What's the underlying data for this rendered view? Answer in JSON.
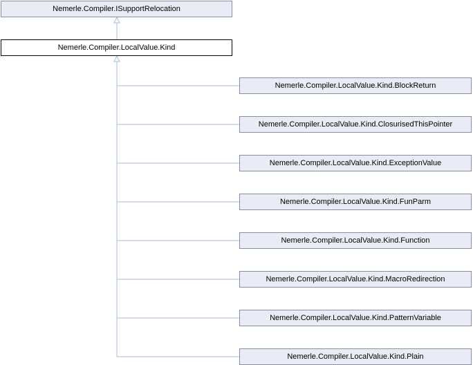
{
  "diagram": {
    "type": "class-inheritance",
    "colors": {
      "node_fill": "#e9ecf4",
      "node_border": "#868fa6",
      "current_fill": "#ffffff",
      "current_border": "#000000",
      "edge": "#a4bedf"
    },
    "interface": {
      "label": "Nemerle.Compiler.ISupportRelocation"
    },
    "current": {
      "label": "Nemerle.Compiler.LocalValue.Kind"
    },
    "derived": [
      {
        "label": "Nemerle.Compiler.LocalValue.Kind.BlockReturn"
      },
      {
        "label": "Nemerle.Compiler.LocalValue.Kind.ClosurisedThisPointer"
      },
      {
        "label": "Nemerle.Compiler.LocalValue.Kind.ExceptionValue"
      },
      {
        "label": "Nemerle.Compiler.LocalValue.Kind.FunParm"
      },
      {
        "label": "Nemerle.Compiler.LocalValue.Kind.Function"
      },
      {
        "label": "Nemerle.Compiler.LocalValue.Kind.MacroRedirection"
      },
      {
        "label": "Nemerle.Compiler.LocalValue.Kind.PatternVariable"
      },
      {
        "label": "Nemerle.Compiler.LocalValue.Kind.Plain"
      }
    ]
  }
}
